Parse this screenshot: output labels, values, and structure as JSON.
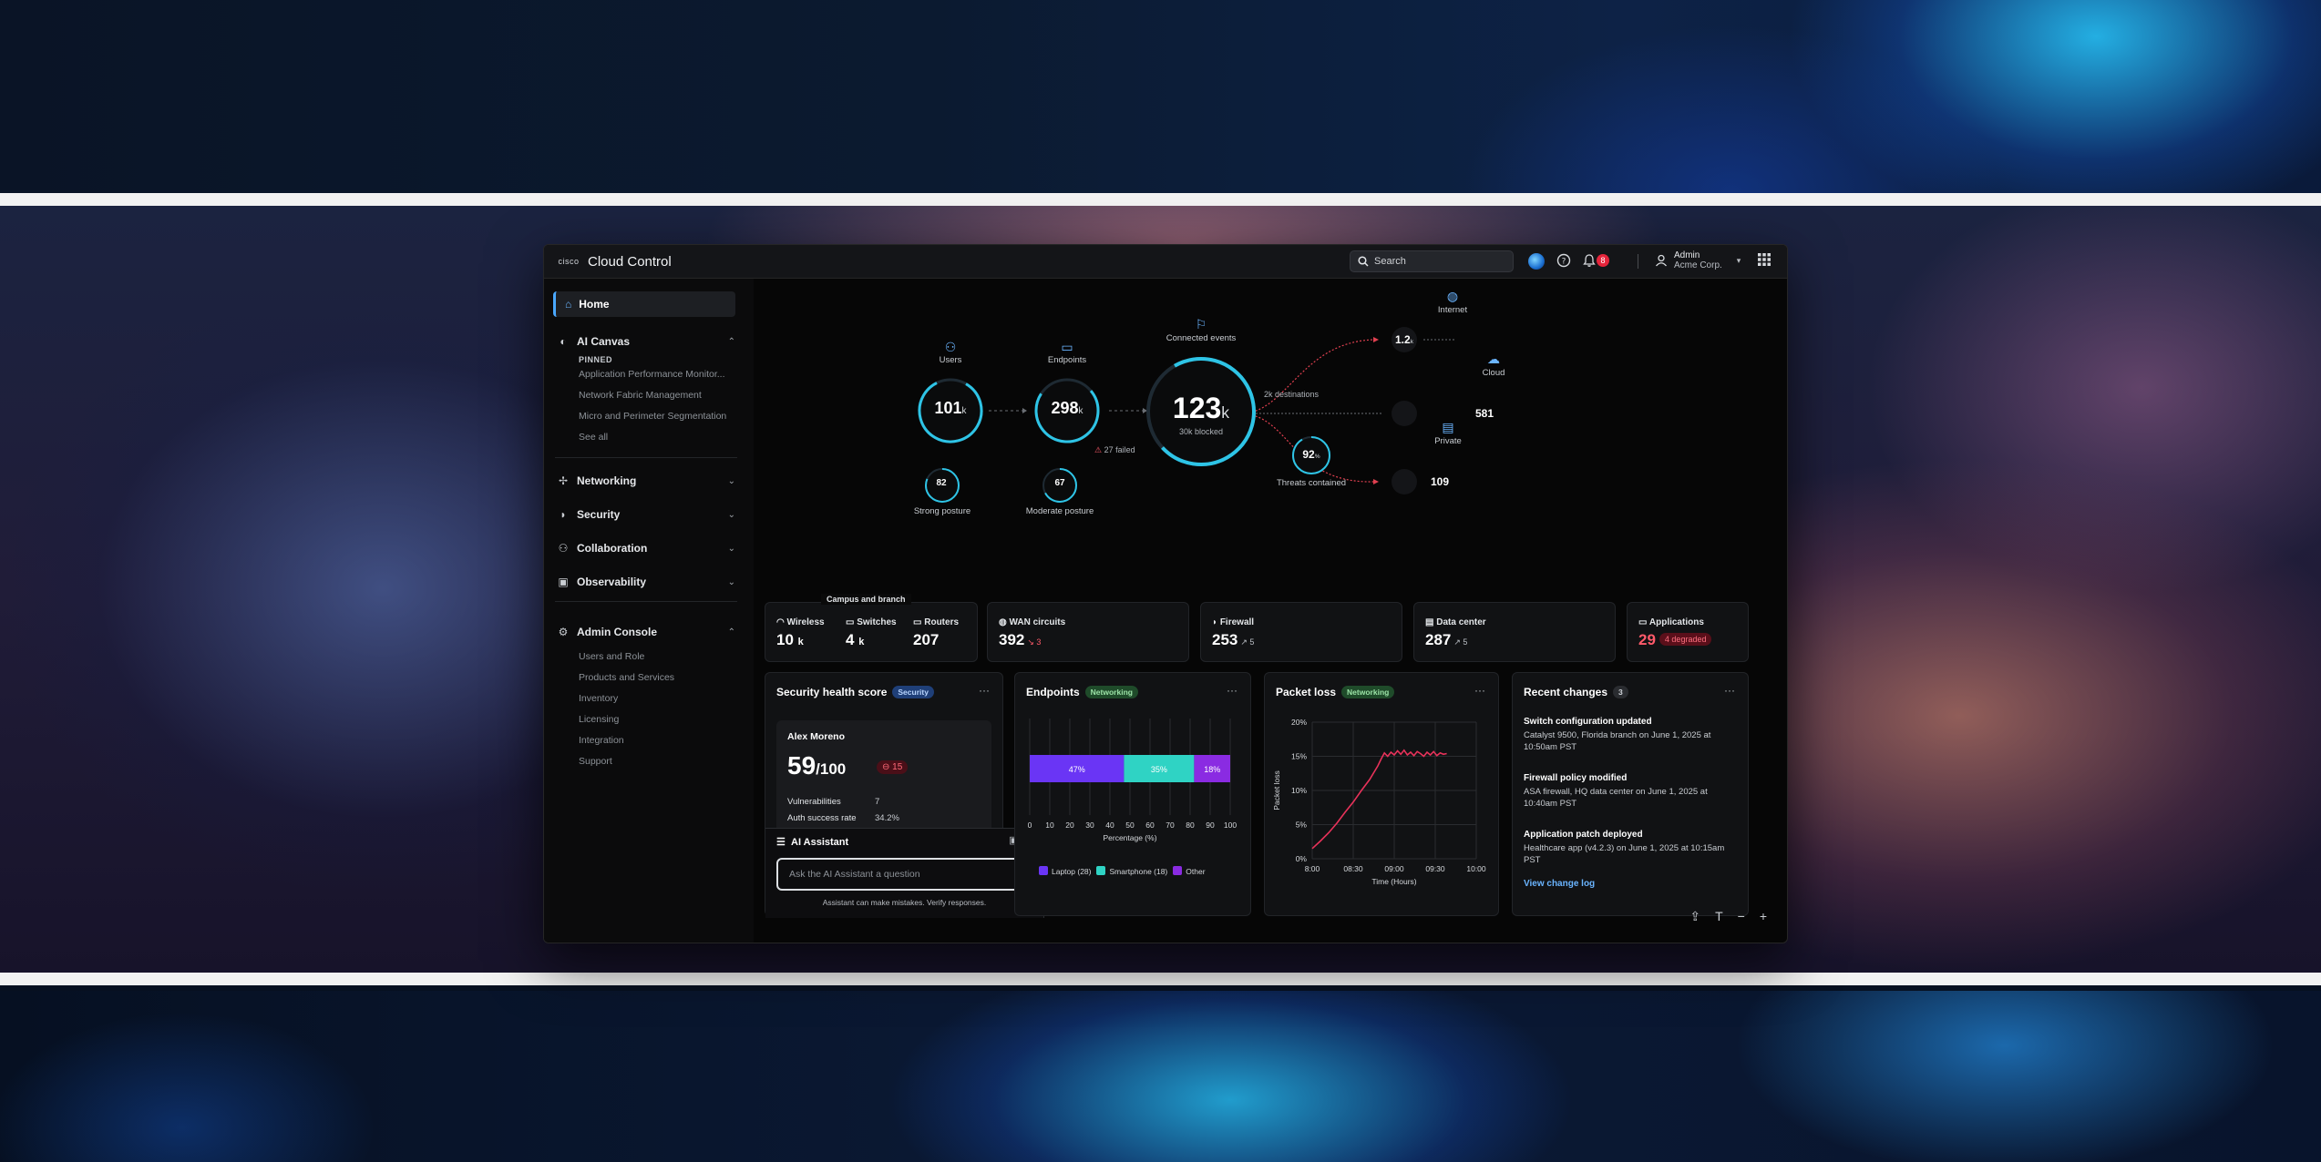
{
  "app": {
    "brand_mark": "cisco",
    "title": "Cloud Control"
  },
  "topbar": {
    "search_label": "Search",
    "notification_count": "8",
    "user_name": "Admin",
    "user_org": "Acme Corp."
  },
  "sidebar": {
    "home": "Home",
    "ai_canvas": {
      "label": "AI Canvas",
      "pinned_label": "PINNED",
      "items": [
        "Application Performance Monitor...",
        "Network Fabric Management",
        "Micro and Perimeter Segmentation",
        "See all"
      ]
    },
    "sections": [
      "Networking",
      "Security",
      "Collaboration",
      "Observability"
    ],
    "admin": {
      "label": "Admin Console",
      "items": [
        "Users and Role",
        "Products and Services",
        "Inventory",
        "Licensing",
        "Integration",
        "Support"
      ]
    }
  },
  "flow": {
    "users": {
      "label": "Users",
      "value": "101",
      "unit": "k"
    },
    "endpoints": {
      "label": "Endpoints",
      "value": "298",
      "unit": "k",
      "note": "27 failed"
    },
    "connected": {
      "label": "Connected events",
      "value": "123",
      "unit": "k",
      "note": "30k blocked"
    },
    "destinations_label": "2k destinations",
    "strong_posture": {
      "value": "82",
      "label": "Strong posture"
    },
    "moderate_posture": {
      "value": "67",
      "label": "Moderate posture"
    },
    "threats": {
      "value": "92",
      "unit": "%",
      "label": "Threats contained"
    },
    "internet": {
      "label": "Internet",
      "value": "1.2",
      "unit": "k"
    },
    "cloud": {
      "label": "Cloud",
      "value": "581"
    },
    "private": {
      "label": "Private",
      "value": "109"
    }
  },
  "summary": {
    "campus_tag": "Campus and branch",
    "wireless": {
      "label": "Wireless",
      "value": "10",
      "unit": "k"
    },
    "switches": {
      "label": "Switches",
      "value": "4",
      "unit": "k"
    },
    "routers": {
      "label": "Routers",
      "value": "207"
    },
    "wan": {
      "label": "WAN circuits",
      "value": "392",
      "trend": "3"
    },
    "firewall": {
      "label": "Firewall",
      "value": "253",
      "trend": "5"
    },
    "datacenter": {
      "label": "Data center",
      "value": "287",
      "trend": "5"
    },
    "applications": {
      "label": "Applications",
      "value": "29",
      "badge": "4 degraded"
    }
  },
  "security_panel": {
    "title": "Security health score",
    "tag": "Security",
    "person": "Alex Moreno",
    "score": "59",
    "score_of": "/100",
    "delta": "15",
    "rows": [
      {
        "label": "Vulnerabilities",
        "value": "7"
      },
      {
        "label": "Auth success rate",
        "value": "34.2%"
      }
    ]
  },
  "assistant": {
    "title": "AI Assistant",
    "placeholder": "Ask the AI Assistant a question",
    "disclaimer": "Assistant can make mistakes. Verify responses."
  },
  "endpoints_panel": {
    "title": "Endpoints",
    "tag": "Networking",
    "xlabel": "Percentage (%)",
    "ticks": [
      "0",
      "10",
      "20",
      "30",
      "40",
      "50",
      "60",
      "70",
      "80",
      "90",
      "100"
    ],
    "legend": [
      "Laptop (28)",
      "Smartphone (18)",
      "Other"
    ],
    "colors": [
      "#6a35f5",
      "#2fd3c4",
      "#8a2be2"
    ]
  },
  "packet_panel": {
    "title": "Packet loss",
    "tag": "Networking",
    "ylabel": "Packet loss",
    "xlabel": "Time (Hours)",
    "yticks": [
      "20%",
      "15%",
      "10%",
      "5%",
      "0%"
    ],
    "xticks": [
      "8:00",
      "08:30",
      "09:00",
      "09:30",
      "10:00"
    ]
  },
  "changes_panel": {
    "title": "Recent changes",
    "count": "3",
    "items": [
      {
        "head": "Switch configuration updated",
        "desc": "Catalyst 9500, Florida branch on June 1, 2025 at 10:50am PST"
      },
      {
        "head": "Firewall policy modified",
        "desc": "ASA firewall, HQ data center on June 1, 2025 at 10:40am PST"
      },
      {
        "head": "Application patch deployed",
        "desc": "Healthcare app (v4.2.3) on June 1, 2025 at 10:15am PST"
      }
    ],
    "link": "View change log"
  },
  "chart_data": [
    {
      "type": "bar",
      "title": "Endpoints",
      "xlabel": "Percentage (%)",
      "orientation": "horizontal-stacked",
      "xlim": [
        0,
        100
      ],
      "series": [
        {
          "name": "Laptop (28)",
          "values": [
            47
          ]
        },
        {
          "name": "Smartphone (18)",
          "values": [
            35
          ]
        },
        {
          "name": "Other",
          "values": [
            18
          ]
        }
      ],
      "data_labels": [
        "47%",
        "35%",
        "18%"
      ]
    },
    {
      "type": "line",
      "title": "Packet loss",
      "xlabel": "Time (Hours)",
      "ylabel": "Packet loss",
      "ylim": [
        0,
        20
      ],
      "x": [
        0,
        0.1,
        0.2,
        0.3,
        0.4,
        0.5,
        0.6,
        0.7,
        0.75,
        0.8,
        0.84,
        0.88,
        0.92,
        0.96,
        1.0,
        1.04,
        1.08,
        1.12,
        1.16,
        1.2,
        1.24,
        1.28,
        1.32,
        1.36,
        1.4,
        1.44,
        1.48,
        1.52,
        1.56,
        1.6,
        1.64
      ],
      "x_units": "hours since 8:00",
      "values": [
        1.5,
        2.6,
        3.8,
        5.2,
        6.8,
        8.3,
        10.0,
        11.6,
        12.6,
        13.6,
        14.6,
        15.5,
        15.0,
        15.6,
        15.2,
        15.8,
        15.3,
        15.9,
        15.2,
        15.6,
        15.1,
        15.7,
        15.4,
        15.0,
        15.6,
        15.2,
        15.7,
        15.1,
        15.5,
        15.3,
        15.4
      ]
    }
  ]
}
